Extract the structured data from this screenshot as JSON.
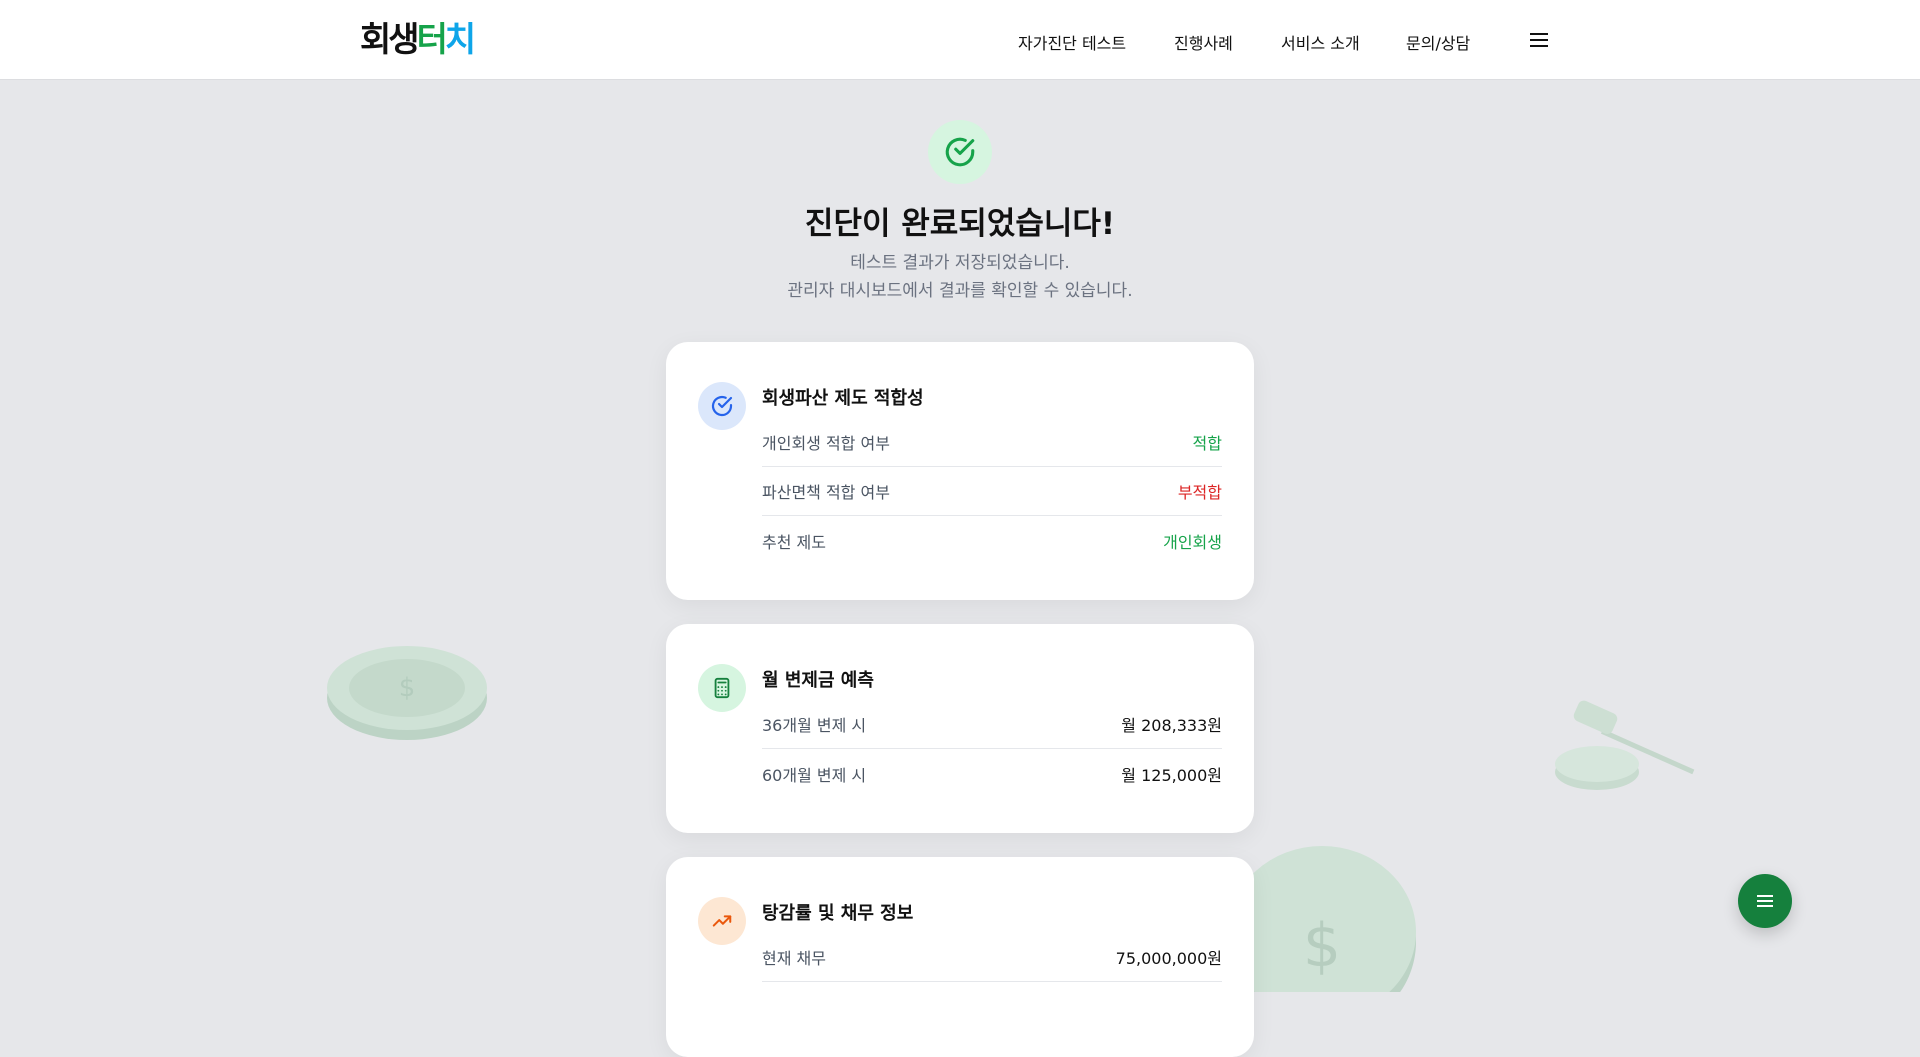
{
  "header": {
    "logo": {
      "part1": "회생",
      "part2": "터",
      "part3": "치"
    },
    "nav": [
      "자가진단 테스트",
      "진행사례",
      "서비스 소개",
      "문의/상담"
    ],
    "menu_icon": "hamburger-icon"
  },
  "hero": {
    "icon": "check-circle-icon",
    "title": "진단이 완료되었습니다!",
    "subtitle_line1": "테스트 결과가 저장되었습니다.",
    "subtitle_line2": "관리자 대시보드에서 결과를 확인할 수 있습니다."
  },
  "cards": [
    {
      "icon": "check-circle-icon",
      "title": "회생파산 제도 적합성",
      "rows": [
        {
          "label": "개인회생 적합 여부",
          "value": "적합",
          "status": "good"
        },
        {
          "label": "파산면책 적합 여부",
          "value": "부적합",
          "status": "bad"
        },
        {
          "label": "추천 제도",
          "value": "개인회생",
          "status": "good"
        }
      ]
    },
    {
      "icon": "calculator-icon",
      "title": "월 변제금 예측",
      "rows": [
        {
          "label": "36개월 변제 시",
          "value": "월 208,333원"
        },
        {
          "label": "60개월 변제 시",
          "value": "월 125,000원"
        }
      ]
    },
    {
      "icon": "trending-up-icon",
      "title": "탕감률 및 채무 정보",
      "rows": [
        {
          "label": "현재 채무",
          "value": "75,000,000원"
        }
      ]
    }
  ],
  "colors": {
    "accent_green": "#16a34a",
    "danger_red": "#dc2626",
    "fab_green": "#15803d",
    "page_bg": "#e6e7ea"
  },
  "fab": {
    "icon": "menu-icon"
  }
}
